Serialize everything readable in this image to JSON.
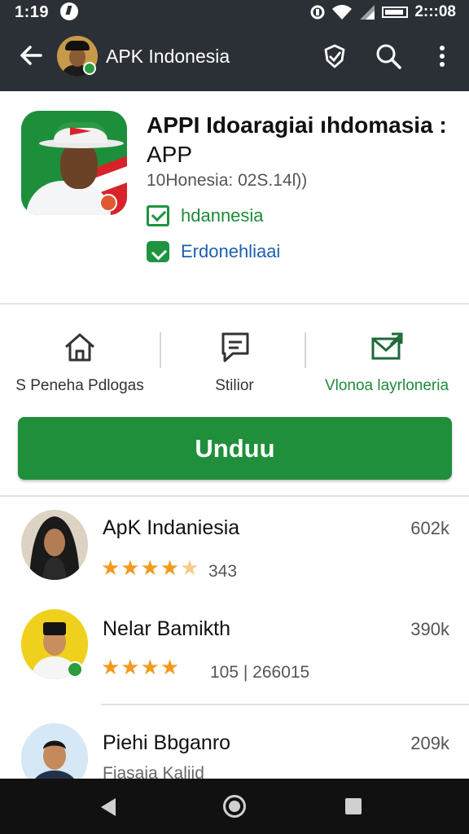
{
  "status_bar": {
    "time": "1:19",
    "time_right": "2:::08"
  },
  "app_bar": {
    "title": "APK Indonesia"
  },
  "app": {
    "name_line1": "APPI Idoaragiai ıhdomasia :",
    "name_line2": "APP",
    "version": "10Honesia: 02S.14ſ))",
    "developer": "hdannesia",
    "category": "Erdonehliaai"
  },
  "actions": [
    {
      "label": "S Peneha Pdlogas"
    },
    {
      "label": "Stilior"
    },
    {
      "label": "Vlonoa layrloneria"
    }
  ],
  "install": {
    "label": "Unduu"
  },
  "reviews": [
    {
      "name": "ApK Indaniesia",
      "size": "602k",
      "rating": 4.5,
      "rating_count": "343"
    },
    {
      "name": "Nelar Bamikth",
      "size": "390k",
      "rating": 4,
      "rating_count": "105 | 266015"
    },
    {
      "name": "Piehi Bbganro",
      "size": "209k",
      "subtitle": "Fiasaia Kaliid"
    }
  ],
  "colors": {
    "app_bar": "#2b3036",
    "accent_green": "#1f8f3c",
    "star": "#f39a1e",
    "link_blue": "#1f5fae"
  },
  "icons": {
    "back": "arrow-left-icon",
    "shield": "shield-check-icon",
    "search": "search-icon",
    "more": "more-vert-icon",
    "home_action": "house-icon",
    "chat_action": "chat-icon",
    "mail_action": "mail-send-icon"
  }
}
